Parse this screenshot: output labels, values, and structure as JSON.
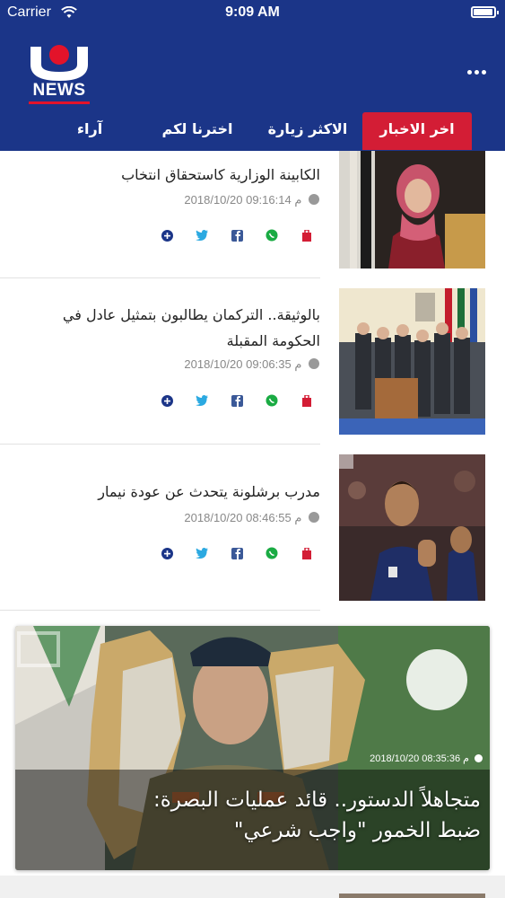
{
  "status_bar": {
    "carrier": "Carrier",
    "time": "9:09 AM",
    "battery_level": 0.95
  },
  "app": {
    "logo_text": "NEWS",
    "menu_icon": "more-dots-icon"
  },
  "tabs": [
    {
      "label": "اخر الاخبار",
      "active": true
    },
    {
      "label": "الاكثر زيارة",
      "active": false
    },
    {
      "label": "اخترنا لكم",
      "active": false
    },
    {
      "label": "آراء",
      "active": false
    }
  ],
  "news": [
    {
      "title_line1": "…في الكابينة الوزارية كاستحقاق انتخاب",
      "title_line2": "الكابينة الوزارية كاستحقاق انتخاب",
      "date": "2018/10/20 09:16:14 م"
    },
    {
      "title_line1": "بالوثيقة.. التركمان يطالبون بتمثيل عادل في",
      "title_line2": "الحكومة المقبلة",
      "date": "2018/10/20 09:06:35 م"
    },
    {
      "title_line1": "مدرب برشلونة يتحدث عن عودة نيمار",
      "title_line2": "",
      "date": "2018/10/20 08:46:55 م"
    }
  ],
  "featured": {
    "title_line1": "متجاهلاً الدستور.. قائد عمليات البصرة:",
    "title_line2": "ضبط الخمور \"واجب شرعي\"",
    "date": "2018/10/20 08:35:36 م"
  },
  "share_icons": [
    "save-icon",
    "whatsapp-icon",
    "facebook-icon",
    "twitter-icon",
    "more-share-icon"
  ],
  "colors": {
    "brand_blue": "#1b3588",
    "accent_red": "#d31d35",
    "whatsapp": "#1aab43",
    "facebook": "#3b5998",
    "twitter": "#2ba9e1"
  }
}
